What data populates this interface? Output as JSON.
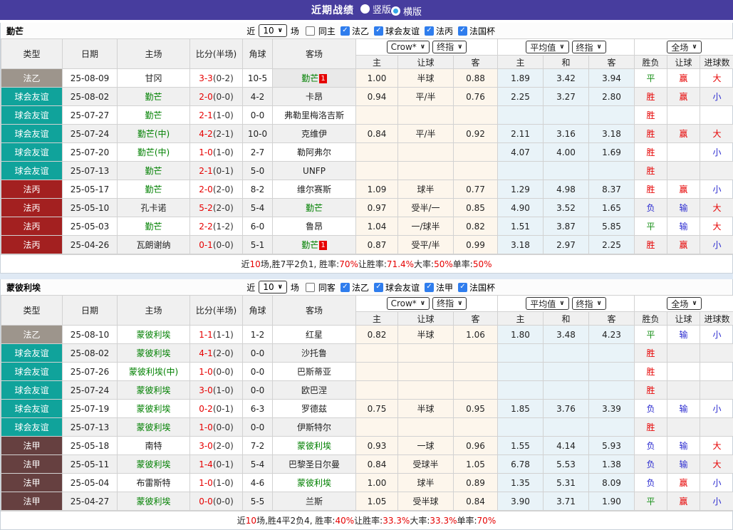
{
  "topbar": {
    "title": "近期战绩",
    "radios": [
      {
        "label": "竖版",
        "selected": false
      },
      {
        "label": "横版",
        "selected": true
      }
    ]
  },
  "colors": {
    "topbar_bg": "#473d9e",
    "league_fa2": "#9d958c",
    "league_friendly": "#10a39b",
    "league_fa3": "#a32020",
    "league_fa1": "#664040",
    "team_green": "#008000",
    "win_red": "#e60000",
    "lose_blue": "#2b2bd0",
    "draw_green": "#189018",
    "crow_col_bg": "#fdf6ec",
    "avg_col_bg": "#e9f3f8"
  },
  "tables": [
    {
      "team": "勤芒",
      "filters": {
        "near_label": "近",
        "count": "10",
        "games_label": "场",
        "same_label": "同主",
        "same_checked": false,
        "leagues": [
          {
            "label": "法乙",
            "checked": true
          },
          {
            "label": "球会友谊",
            "checked": true
          },
          {
            "label": "法丙",
            "checked": true
          },
          {
            "label": "法国杯",
            "checked": true
          }
        ]
      },
      "selects": {
        "odds": "Crow*",
        "odds_ref": "终指",
        "avg": "平均值",
        "avg_ref": "终指",
        "scope": "全场"
      },
      "columns": {
        "type": "类型",
        "date": "日期",
        "home": "主场",
        "score": "比分(半场)",
        "corner": "角球",
        "away": "客场",
        "odds_sub": [
          "主",
          "让球",
          "客"
        ],
        "avg_sub": [
          "主",
          "和",
          "客"
        ],
        "scope_sub": [
          "胜负",
          "让球",
          "进球数"
        ]
      },
      "rows": [
        {
          "league": "法乙",
          "league_key": "fa2",
          "date": "25-08-09",
          "home": "甘冈",
          "home_green": false,
          "score": "3-3",
          "half": "(0-2)",
          "corner": "10-5",
          "away": "勤芒",
          "away_green": true,
          "away_badge": "1",
          "away_hl": true,
          "odds": [
            "1.00",
            "半球",
            "0.88"
          ],
          "avg": [
            "1.89",
            "3.42",
            "3.94"
          ],
          "result": [
            [
              "平",
              "g"
            ],
            [
              "赢",
              "r"
            ],
            [
              "大",
              "r"
            ]
          ]
        },
        {
          "league": "球会友谊",
          "league_key": "friend",
          "date": "25-08-02",
          "home": "勤芒",
          "home_green": true,
          "score": "2-0",
          "half": "(0-0)",
          "corner": "4-2",
          "away": "卡昂",
          "away_green": false,
          "away_badge": null,
          "away_hl": false,
          "odds": [
            "0.94",
            "平/半",
            "0.76"
          ],
          "avg": [
            "2.25",
            "3.27",
            "2.80"
          ],
          "result": [
            [
              "胜",
              "r"
            ],
            [
              "赢",
              "r"
            ],
            [
              "小",
              "b"
            ]
          ]
        },
        {
          "league": "球会友谊",
          "league_key": "friend",
          "date": "25-07-27",
          "home": "勤芒",
          "home_green": true,
          "score": "2-1",
          "half": "(1-0)",
          "corner": "0-0",
          "away": "弗勒里梅洛吉斯",
          "away_green": false,
          "away_badge": null,
          "away_hl": false,
          "odds": [
            "",
            "",
            ""
          ],
          "avg": [
            "",
            "",
            ""
          ],
          "result": [
            [
              "胜",
              "r"
            ],
            null,
            null
          ]
        },
        {
          "league": "球会友谊",
          "league_key": "friend",
          "date": "25-07-24",
          "home": "勤芒(中)",
          "home_green": true,
          "score": "4-2",
          "half": "(2-1)",
          "corner": "10-0",
          "away": "克维伊",
          "away_green": false,
          "away_badge": null,
          "away_hl": false,
          "odds": [
            "0.84",
            "平/半",
            "0.92"
          ],
          "avg": [
            "2.11",
            "3.16",
            "3.18"
          ],
          "result": [
            [
              "胜",
              "r"
            ],
            [
              "赢",
              "r"
            ],
            [
              "大",
              "r"
            ]
          ]
        },
        {
          "league": "球会友谊",
          "league_key": "friend",
          "date": "25-07-20",
          "home": "勤芒(中)",
          "home_green": true,
          "score": "1-0",
          "half": "(1-0)",
          "corner": "2-7",
          "away": "勒阿弗尔",
          "away_green": false,
          "away_badge": null,
          "away_hl": false,
          "odds": [
            "",
            "",
            ""
          ],
          "avg": [
            "4.07",
            "4.00",
            "1.69"
          ],
          "result": [
            [
              "胜",
              "r"
            ],
            null,
            [
              "小",
              "b"
            ]
          ]
        },
        {
          "league": "球会友谊",
          "league_key": "friend",
          "date": "25-07-13",
          "home": "勤芒",
          "home_green": true,
          "score": "2-1",
          "half": "(0-1)",
          "corner": "5-0",
          "away": "UNFP",
          "away_green": false,
          "away_badge": null,
          "away_hl": false,
          "odds": [
            "",
            "",
            ""
          ],
          "avg": [
            "",
            "",
            ""
          ],
          "result": [
            [
              "胜",
              "r"
            ],
            null,
            null
          ]
        },
        {
          "league": "法丙",
          "league_key": "fa3",
          "date": "25-05-17",
          "home": "勤芒",
          "home_green": true,
          "score": "2-0",
          "half": "(2-0)",
          "corner": "8-2",
          "away": "维尔赛斯",
          "away_green": false,
          "away_badge": null,
          "away_hl": false,
          "odds": [
            "1.09",
            "球半",
            "0.77"
          ],
          "avg": [
            "1.29",
            "4.98",
            "8.37"
          ],
          "result": [
            [
              "胜",
              "r"
            ],
            [
              "赢",
              "r"
            ],
            [
              "小",
              "b"
            ]
          ]
        },
        {
          "league": "法丙",
          "league_key": "fa3",
          "date": "25-05-10",
          "home": "孔卡诺",
          "home_green": false,
          "score": "5-2",
          "half": "(2-0)",
          "corner": "5-4",
          "away": "勤芒",
          "away_green": true,
          "away_badge": null,
          "away_hl": false,
          "odds": [
            "0.97",
            "受半/一",
            "0.85"
          ],
          "avg": [
            "4.90",
            "3.52",
            "1.65"
          ],
          "result": [
            [
              "负",
              "b"
            ],
            [
              "输",
              "b"
            ],
            [
              "大",
              "r"
            ]
          ]
        },
        {
          "league": "法丙",
          "league_key": "fa3",
          "date": "25-05-03",
          "home": "勤芒",
          "home_green": true,
          "score": "2-2",
          "half": "(1-2)",
          "corner": "6-0",
          "away": "鲁昂",
          "away_green": false,
          "away_badge": null,
          "away_hl": false,
          "odds": [
            "1.04",
            "一/球半",
            "0.82"
          ],
          "avg": [
            "1.51",
            "3.87",
            "5.85"
          ],
          "result": [
            [
              "平",
              "g"
            ],
            [
              "输",
              "b"
            ],
            [
              "大",
              "r"
            ]
          ]
        },
        {
          "league": "法丙",
          "league_key": "fa3",
          "date": "25-04-26",
          "home": "瓦朗谢纳",
          "home_green": false,
          "score": "0-1",
          "half": "(0-0)",
          "corner": "5-1",
          "away": "勤芒",
          "away_green": true,
          "away_badge": "1",
          "away_hl": false,
          "odds": [
            "0.87",
            "受平/半",
            "0.99"
          ],
          "avg": [
            "3.18",
            "2.97",
            "2.25"
          ],
          "result": [
            [
              "胜",
              "r"
            ],
            [
              "赢",
              "r"
            ],
            [
              "小",
              "b"
            ]
          ]
        }
      ],
      "summary": [
        {
          "t": "近",
          "red": false
        },
        {
          "t": "10",
          "red": true
        },
        {
          "t": "场,胜7平2负1, 胜率:",
          "red": false
        },
        {
          "t": "70%",
          "red": true
        },
        {
          "t": " 让胜率:",
          "red": false
        },
        {
          "t": "71.4%",
          "red": true
        },
        {
          "t": " 大率:",
          "red": false
        },
        {
          "t": "50%",
          "red": true
        },
        {
          "t": " 单率:",
          "red": false
        },
        {
          "t": "50%",
          "red": true
        }
      ]
    },
    {
      "team": "蒙彼利埃",
      "filters": {
        "near_label": "近",
        "count": "10",
        "games_label": "场",
        "same_label": "同客",
        "same_checked": false,
        "leagues": [
          {
            "label": "法乙",
            "checked": true
          },
          {
            "label": "球会友谊",
            "checked": true
          },
          {
            "label": "法甲",
            "checked": true
          },
          {
            "label": "法国杯",
            "checked": true
          }
        ]
      },
      "selects": {
        "odds": "Crow*",
        "odds_ref": "终指",
        "avg": "平均值",
        "avg_ref": "终指",
        "scope": "全场"
      },
      "columns": {
        "type": "类型",
        "date": "日期",
        "home": "主场",
        "score": "比分(半场)",
        "corner": "角球",
        "away": "客场",
        "odds_sub": [
          "主",
          "让球",
          "客"
        ],
        "avg_sub": [
          "主",
          "和",
          "客"
        ],
        "scope_sub": [
          "胜负",
          "让球",
          "进球数"
        ]
      },
      "rows": [
        {
          "league": "法乙",
          "league_key": "fa2",
          "date": "25-08-10",
          "home": "蒙彼利埃",
          "home_green": true,
          "score": "1-1",
          "half": "(1-1)",
          "corner": "1-2",
          "away": "红星",
          "away_green": false,
          "away_badge": null,
          "away_hl": false,
          "odds": [
            "0.82",
            "半球",
            "1.06"
          ],
          "avg": [
            "1.80",
            "3.48",
            "4.23"
          ],
          "result": [
            [
              "平",
              "g"
            ],
            [
              "输",
              "b"
            ],
            [
              "小",
              "b"
            ]
          ]
        },
        {
          "league": "球会友谊",
          "league_key": "friend",
          "date": "25-08-02",
          "home": "蒙彼利埃",
          "home_green": true,
          "score": "4-1",
          "half": "(2-0)",
          "corner": "0-0",
          "away": "沙托鲁",
          "away_green": false,
          "away_badge": null,
          "away_hl": false,
          "odds": [
            "",
            "",
            ""
          ],
          "avg": [
            "",
            "",
            ""
          ],
          "result": [
            [
              "胜",
              "r"
            ],
            null,
            null
          ]
        },
        {
          "league": "球会友谊",
          "league_key": "friend",
          "date": "25-07-26",
          "home": "蒙彼利埃(中)",
          "home_green": true,
          "score": "1-0",
          "half": "(0-0)",
          "corner": "0-0",
          "away": "巴斯蒂亚",
          "away_green": false,
          "away_badge": null,
          "away_hl": false,
          "odds": [
            "",
            "",
            ""
          ],
          "avg": [
            "",
            "",
            ""
          ],
          "result": [
            [
              "胜",
              "r"
            ],
            null,
            null
          ]
        },
        {
          "league": "球会友谊",
          "league_key": "friend",
          "date": "25-07-24",
          "home": "蒙彼利埃",
          "home_green": true,
          "score": "3-0",
          "half": "(1-0)",
          "corner": "0-0",
          "away": "欧巴涅",
          "away_green": false,
          "away_badge": null,
          "away_hl": false,
          "odds": [
            "",
            "",
            ""
          ],
          "avg": [
            "",
            "",
            ""
          ],
          "result": [
            [
              "胜",
              "r"
            ],
            null,
            null
          ]
        },
        {
          "league": "球会友谊",
          "league_key": "friend",
          "date": "25-07-19",
          "home": "蒙彼利埃",
          "home_green": true,
          "score": "0-2",
          "half": "(0-1)",
          "corner": "6-3",
          "away": "罗德兹",
          "away_green": false,
          "away_badge": null,
          "away_hl": false,
          "odds": [
            "0.75",
            "半球",
            "0.95"
          ],
          "avg": [
            "1.85",
            "3.76",
            "3.39"
          ],
          "result": [
            [
              "负",
              "b"
            ],
            [
              "输",
              "b"
            ],
            [
              "小",
              "b"
            ]
          ]
        },
        {
          "league": "球会友谊",
          "league_key": "friend",
          "date": "25-07-13",
          "home": "蒙彼利埃",
          "home_green": true,
          "score": "1-0",
          "half": "(0-0)",
          "corner": "0-0",
          "away": "伊斯特尔",
          "away_green": false,
          "away_badge": null,
          "away_hl": false,
          "odds": [
            "",
            "",
            ""
          ],
          "avg": [
            "",
            "",
            ""
          ],
          "result": [
            [
              "胜",
              "r"
            ],
            null,
            null
          ]
        },
        {
          "league": "法甲",
          "league_key": "fa1",
          "date": "25-05-18",
          "home": "南特",
          "home_green": false,
          "score": "3-0",
          "half": "(2-0)",
          "corner": "7-2",
          "away": "蒙彼利埃",
          "away_green": true,
          "away_badge": null,
          "away_hl": false,
          "odds": [
            "0.93",
            "一球",
            "0.96"
          ],
          "avg": [
            "1.55",
            "4.14",
            "5.93"
          ],
          "result": [
            [
              "负",
              "b"
            ],
            [
              "输",
              "b"
            ],
            [
              "大",
              "r"
            ]
          ]
        },
        {
          "league": "法甲",
          "league_key": "fa1",
          "date": "25-05-11",
          "home": "蒙彼利埃",
          "home_green": true,
          "score": "1-4",
          "half": "(0-1)",
          "corner": "5-4",
          "away": "巴黎圣日尔曼",
          "away_green": false,
          "away_badge": null,
          "away_hl": false,
          "odds": [
            "0.84",
            "受球半",
            "1.05"
          ],
          "avg": [
            "6.78",
            "5.53",
            "1.38"
          ],
          "result": [
            [
              "负",
              "b"
            ],
            [
              "输",
              "b"
            ],
            [
              "大",
              "r"
            ]
          ]
        },
        {
          "league": "法甲",
          "league_key": "fa1",
          "date": "25-05-04",
          "home": "布雷斯特",
          "home_green": false,
          "score": "1-0",
          "half": "(1-0)",
          "corner": "4-6",
          "away": "蒙彼利埃",
          "away_green": true,
          "away_badge": null,
          "away_hl": false,
          "odds": [
            "1.00",
            "球半",
            "0.89"
          ],
          "avg": [
            "1.35",
            "5.31",
            "8.09"
          ],
          "result": [
            [
              "负",
              "b"
            ],
            [
              "赢",
              "r"
            ],
            [
              "小",
              "b"
            ]
          ]
        },
        {
          "league": "法甲",
          "league_key": "fa1",
          "date": "25-04-27",
          "home": "蒙彼利埃",
          "home_green": true,
          "score": "0-0",
          "half": "(0-0)",
          "corner": "5-5",
          "away": "兰斯",
          "away_green": false,
          "away_badge": null,
          "away_hl": false,
          "odds": [
            "1.05",
            "受半球",
            "0.84"
          ],
          "avg": [
            "3.90",
            "3.71",
            "1.90"
          ],
          "result": [
            [
              "平",
              "g"
            ],
            [
              "赢",
              "r"
            ],
            [
              "小",
              "b"
            ]
          ]
        }
      ],
      "summary": [
        {
          "t": "近",
          "red": false
        },
        {
          "t": "10",
          "red": true
        },
        {
          "t": "场,胜4平2负4, 胜率:",
          "red": false
        },
        {
          "t": "40%",
          "red": true
        },
        {
          "t": " 让胜率:",
          "red": false
        },
        {
          "t": "33.3%",
          "red": true
        },
        {
          "t": " 大率:",
          "red": false
        },
        {
          "t": "33.3%",
          "red": true
        },
        {
          "t": " 单率:",
          "red": false
        },
        {
          "t": "70%",
          "red": true
        }
      ]
    }
  ]
}
